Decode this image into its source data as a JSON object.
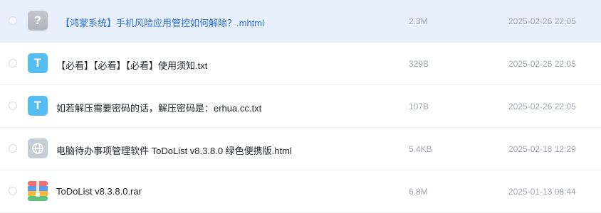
{
  "files": [
    {
      "name": "【鸿蒙系统】手机风险应用管控如何解除？.mhtml",
      "size": "2.3M",
      "date": "2025-02-26 22:05",
      "icon": "question-icon",
      "icon_glyph": "?",
      "selected": true
    },
    {
      "name": "【必看】【必看】【必看】使用须知.txt",
      "size": "329B",
      "date": "2025-02-26 22:05",
      "icon": "txt-file-icon",
      "icon_glyph": "T",
      "selected": false
    },
    {
      "name": "如若解压需要密码的话，解压密码是：erhua.cc.txt",
      "size": "107B",
      "date": "2025-02-26 22:05",
      "icon": "txt-file-icon",
      "icon_glyph": "T",
      "selected": false
    },
    {
      "name": "电脑待办事项管理软件 ToDoList v8.3.8.0 绿色便携版.html",
      "size": "5.4KB",
      "date": "2025-02-18 12:29",
      "icon": "globe-icon",
      "selected": false
    },
    {
      "name": "ToDoList v8.3.8.0.rar",
      "size": "6.8M",
      "date": "2025-01-13 08:44",
      "icon": "archive-icon",
      "selected": false
    }
  ],
  "colors": {
    "selected_row_bg": "#e9f0fd",
    "selected_name": "#2d72e0",
    "txt_icon": "#54bdf2",
    "meta_text": "#a2a7b0"
  }
}
